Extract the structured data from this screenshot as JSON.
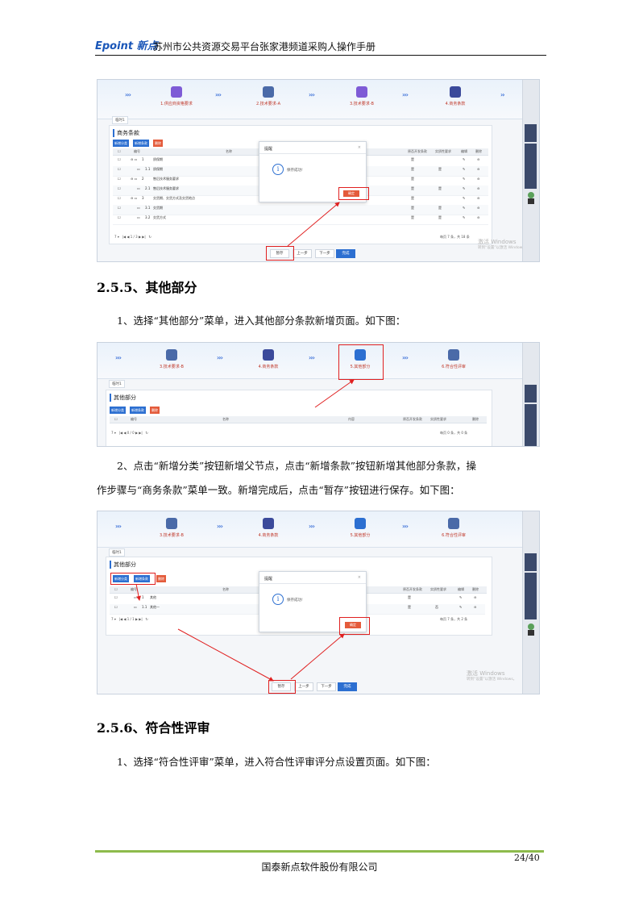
{
  "header": {
    "logo": "Epoint 新点",
    "title": "苏州市公共资源交易平台张家港频道采购人操作手册"
  },
  "section_555": {
    "heading": "2.5.5、其他部分",
    "para1": "1、选择“其他部分”菜单，进入其他部分条款新增页面。如下图：",
    "para2_line1": "2、点击“新增分类”按钮新增父节点，点击“新增条款”按钮新增其他部分条款，操",
    "para2_line2": "作步骤与“商务条款”菜单一致。新增完成后，点击“暂存”按钮进行保存。如下图："
  },
  "section_556": {
    "heading": "2.5.6、符合性评审",
    "para1": "1、选择“符合性评审”菜单，进入符合性评审评分点设置页面。如下图："
  },
  "footer": {
    "page": "24/40",
    "company": "国泰新点软件股份有限公司"
  },
  "shot1": {
    "steps": [
      "1.供应商资格要求",
      "2.技术要求-A",
      "3.技术要求-B",
      "4.商务条款"
    ],
    "tab": "临时1",
    "panel_title": "商务条款",
    "buttons": [
      "新增分类",
      "新增条款",
      "删除"
    ],
    "columns": [
      "编号",
      "名称",
      "原否开发条款",
      "实质性要求",
      "编辑",
      "删除"
    ],
    "rows": [
      {
        "no": "1",
        "name": "质保期",
        "a": "是",
        "b": "",
        "tree": true
      },
      {
        "no": "1.1",
        "name": "质保期",
        "a": "是",
        "b": "是",
        "tree": false
      },
      {
        "no": "2",
        "name": "售后技术服务要求",
        "a": "是",
        "b": "",
        "tree": true
      },
      {
        "no": "2.1",
        "name": "售后技术服务要求",
        "a": "是",
        "b": "是",
        "tree": false
      },
      {
        "no": "3",
        "name": "交货期、交货方式及交货地点",
        "a": "是",
        "b": "",
        "tree": true
      },
      {
        "no": "3.1",
        "name": "交货期",
        "a": "是",
        "b": "是",
        "tree": false
      },
      {
        "no": "3.2",
        "name": "交货方式",
        "a": "是",
        "b": "是",
        "tree": false
      }
    ],
    "pager": "1 / 3",
    "pager_right": "每页 7 条，共 18 条",
    "dialog_title": "提醒",
    "dialog_msg": "保存成功!",
    "ok": "确定",
    "nav": [
      "暂存",
      "上一步",
      "下一步",
      "完成"
    ],
    "watermark": "激活 Windows",
    "watermark_sub": "转到“设置”以激活 Windows。"
  },
  "shot2": {
    "steps": [
      "3.技术要求-B",
      "4.商务条款",
      "5.其他部分",
      "6.符合性评审"
    ],
    "tab": "临时1",
    "panel_title": "其他部分",
    "buttons": [
      "新增分类",
      "新增条款",
      "删除"
    ],
    "columns": [
      "编号",
      "名称",
      "内容",
      "原否开发条款",
      "实质性要求",
      "删除"
    ],
    "pager": "0 / 0",
    "pager_right": "每页 0 条，共 0 条"
  },
  "shot3": {
    "steps": [
      "3.技术要求-B",
      "4.商务条款",
      "5.其他部分",
      "6.符合性评审"
    ],
    "tab": "临时1",
    "panel_title": "其他部分",
    "buttons": [
      "新增分类",
      "新增条款",
      "删除"
    ],
    "columns": [
      "编号",
      "名称",
      "原否开发条款",
      "实质性要求",
      "编辑",
      "删除"
    ],
    "rows": [
      {
        "no": "1",
        "name": "其他",
        "a": "是",
        "b": ""
      },
      {
        "no": "1.1",
        "name": "其他一",
        "a": "是",
        "b": "否"
      }
    ],
    "pager": "1 / 1",
    "pager_right": "每页 7 条，共 2 条",
    "dialog_title": "提醒",
    "dialog_msg": "保存成功!",
    "ok": "确定",
    "nav": [
      "暂存",
      "上一步",
      "下一步",
      "完成"
    ],
    "watermark": "激活 Windows",
    "watermark_sub": "转到“设置”以激活 Windows。"
  },
  "colors": {
    "accent": "#2c6fd1",
    "highlight": "#e02020",
    "footer_bar": "#8dbb4c"
  }
}
